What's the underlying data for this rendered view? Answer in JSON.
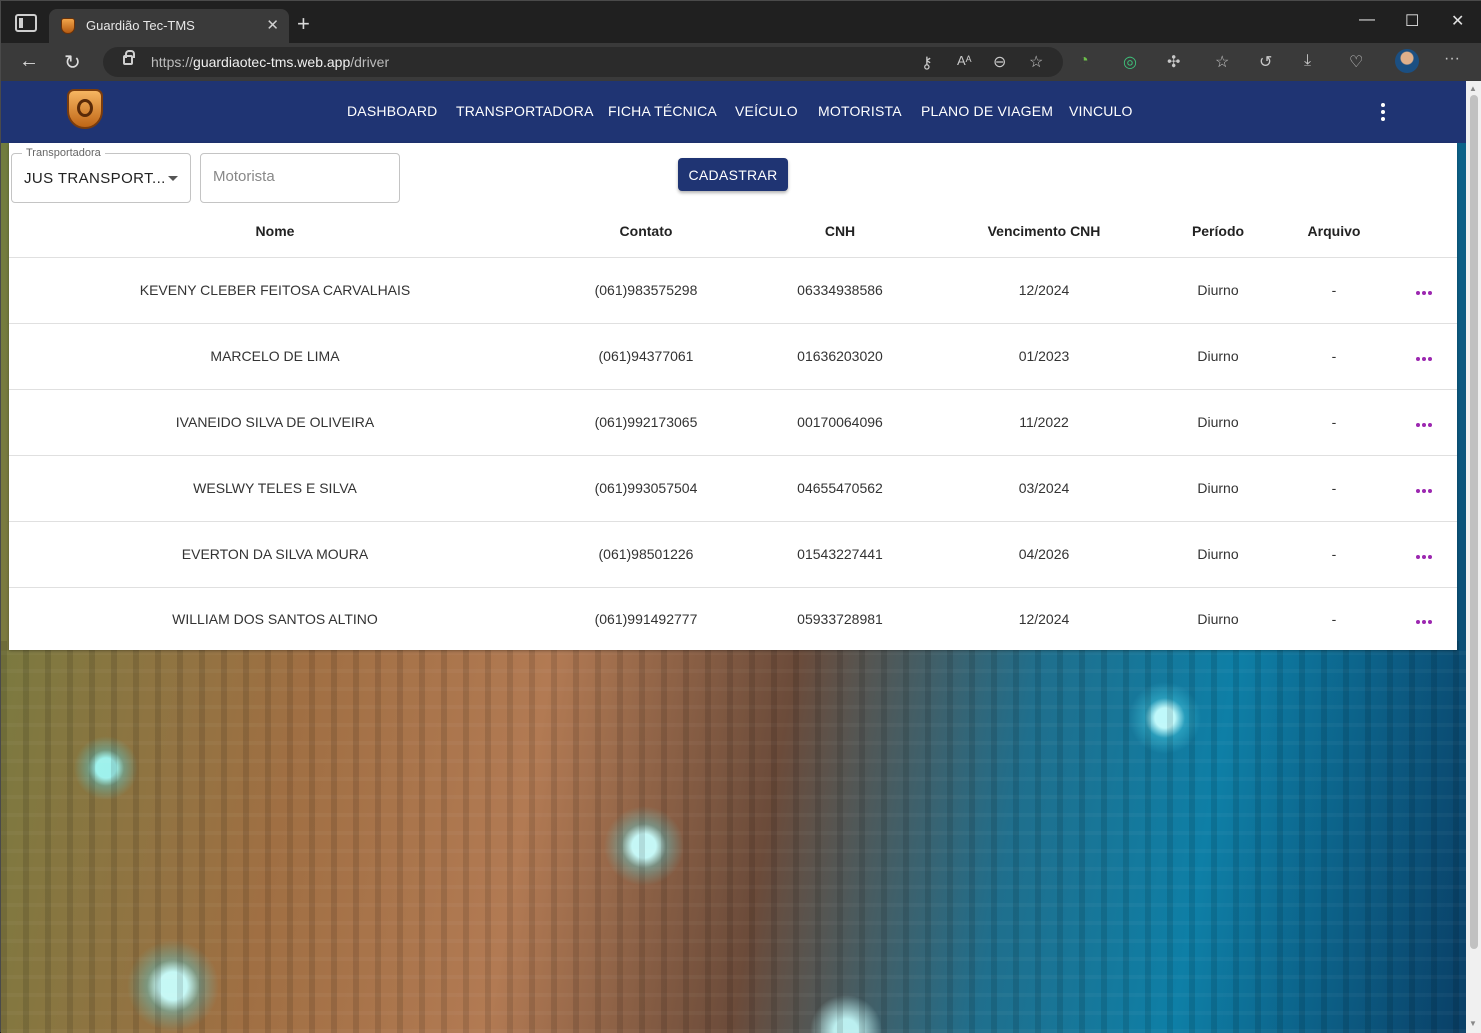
{
  "browser": {
    "tab_title": "Guardião Tec-TMS",
    "url_prefix": "https://",
    "url_host": "guardiaotec-tms.web.app",
    "url_path": "/driver"
  },
  "app": {
    "menu": [
      "DASHBOARD",
      "TRANSPORTADORA",
      "FICHA TÉCNICA",
      "VEÍCULO",
      "MOTORISTA",
      "PLANO DE VIAGEM",
      "VINCULO"
    ]
  },
  "filters": {
    "transportadora_label": "Transportadora",
    "transportadora_value": "JUS TRANSPORT...",
    "motorista_placeholder": "Motorista",
    "cadastrar_label": "CADASTRAR"
  },
  "table": {
    "headers": [
      "Nome",
      "Contato",
      "CNH",
      "Vencimento CNH",
      "Período",
      "Arquivo"
    ],
    "rows": [
      [
        "KEVENY CLEBER FEITOSA CARVALHAIS",
        "(061)983575298",
        "06334938586",
        "12/2024",
        "Diurno",
        "-"
      ],
      [
        "MARCELO DE LIMA",
        "(061)94377061",
        "01636203020",
        "01/2023",
        "Diurno",
        "-"
      ],
      [
        "IVANEIDO SILVA DE OLIVEIRA",
        "(061)992173065",
        "00170064096",
        "11/2022",
        "Diurno",
        "-"
      ],
      [
        "WESLWY TELES E SILVA",
        "(061)993057504",
        "04655470562",
        "03/2024",
        "Diurno",
        "-"
      ],
      [
        "EVERTON DA SILVA MOURA",
        "(061)98501226",
        "01543227441",
        "04/2026",
        "Diurno",
        "-"
      ],
      [
        "WILLIAM DOS SANTOS ALTINO",
        "(061)991492777",
        "05933728981",
        "12/2024",
        "Diurno",
        "-"
      ]
    ]
  },
  "colors": {
    "appbar": "#1f3473",
    "row_action": "#9c27b0"
  }
}
